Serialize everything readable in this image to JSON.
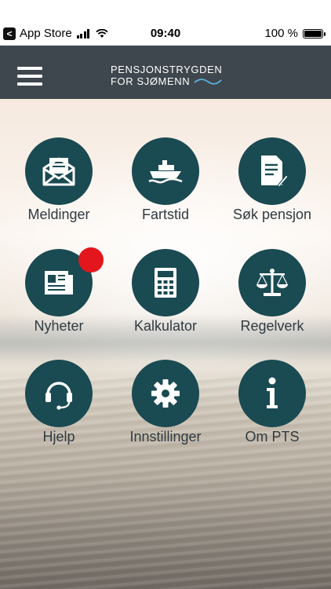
{
  "status_bar": {
    "back_app": "App Store",
    "back_glyph": "<",
    "time": "09:40",
    "battery": "100 %",
    "battery_level": 1.0
  },
  "header": {
    "brand_line1": "PENSJONSTRYGDEN",
    "brand_line2": "FOR SJØMENN",
    "menu_icon": "hamburger-icon"
  },
  "colors": {
    "header_bg": "#3e474d",
    "tile_circle": "#1a4a52",
    "notification": "#e2161c",
    "wave_accent": "#5bb3e0"
  },
  "menu": [
    {
      "label": "Meldinger",
      "icon": "envelope-icon",
      "notification": false
    },
    {
      "label": "Fartstid",
      "icon": "ship-icon",
      "notification": false
    },
    {
      "label": "Søk pensjon",
      "icon": "document-icon",
      "notification": false
    },
    {
      "label": "Nyheter",
      "icon": "newspaper-icon",
      "notification": true
    },
    {
      "label": "Kalkulator",
      "icon": "calculator-icon",
      "notification": false
    },
    {
      "label": "Regelverk",
      "icon": "scales-icon",
      "notification": false
    },
    {
      "label": "Hjelp",
      "icon": "headset-icon",
      "notification": false
    },
    {
      "label": "Innstillinger",
      "icon": "gear-icon",
      "notification": false
    },
    {
      "label": "Om PTS",
      "icon": "info-icon",
      "notification": false
    }
  ]
}
